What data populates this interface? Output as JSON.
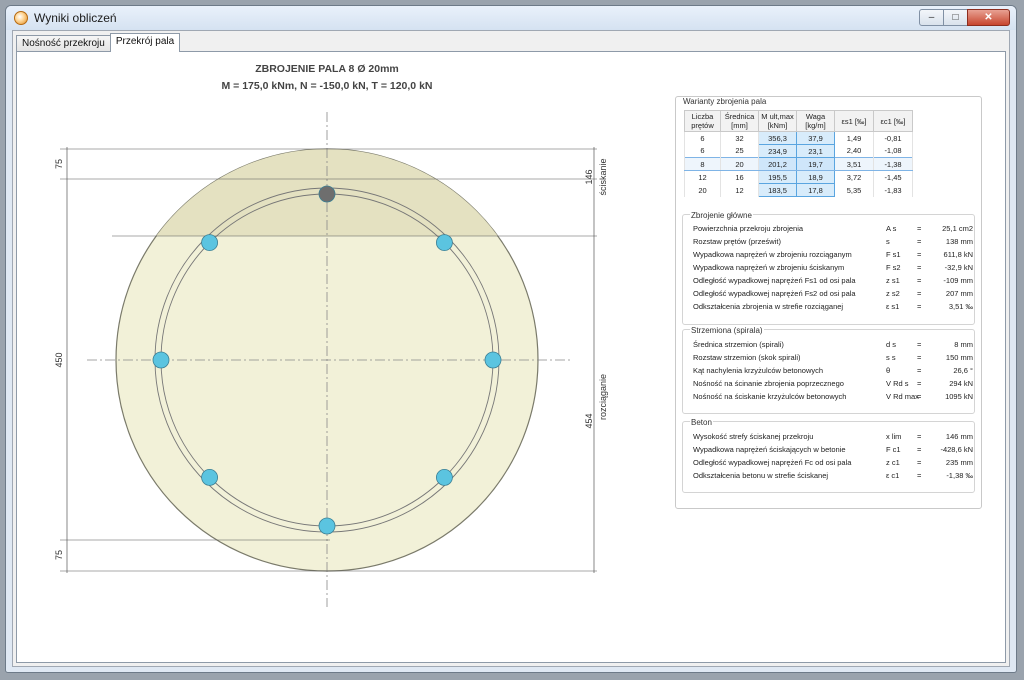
{
  "window": {
    "title": "Wyniki obliczeń",
    "buttons": {
      "minimize": "–",
      "maximize": "□",
      "close": "✕"
    }
  },
  "tabs": [
    {
      "label": "Nośność przekroju"
    },
    {
      "label": "Przekrój pala"
    }
  ],
  "drawing": {
    "title": "ZBROJENIE PALA 8 Ø 20mm",
    "subtitle": "M = 175,0 kNm,  N = -150,0 kN,  T = 120,0 kN",
    "dim_left": [
      "75",
      "450",
      "75"
    ],
    "dim_right": [
      "146",
      "454"
    ],
    "zone_labels": [
      "ściskanie",
      "rozciąganie"
    ],
    "colors": {
      "concrete": "#f2f1d8",
      "compressed": "#e4e1c1",
      "bar": "#5bc4e0",
      "bar_active": "#6e6e6e"
    }
  },
  "variants": {
    "title": "Warianty zbrojenia pala",
    "headers": [
      "Liczba prętów",
      "Średnica [mm]",
      "M ult,max [kNm]",
      "Waga [kg/m]",
      "εs1 [‰]",
      "εc1 [‰]"
    ],
    "rows": [
      [
        "6",
        "32",
        "356,3",
        "37,9",
        "1,49",
        "-0,81"
      ],
      [
        "6",
        "25",
        "234,9",
        "23,1",
        "2,40",
        "-1,08"
      ],
      [
        "8",
        "20",
        "201,2",
        "19,7",
        "3,51",
        "-1,38"
      ],
      [
        "12",
        "16",
        "195,5",
        "18,9",
        "3,72",
        "-1,45"
      ],
      [
        "20",
        "12",
        "183,5",
        "17,8",
        "5,35",
        "-1,83"
      ]
    ],
    "selected_row": 2
  },
  "main_reinf": {
    "title": "Zbrojenie główne",
    "rows": [
      {
        "label": "Powierzchnia przekroju zbrojenia",
        "symbol": "A s",
        "value": "25,1 cm2"
      },
      {
        "label": "Rozstaw prętów (prześwit)",
        "symbol": "s",
        "value": "138 mm"
      },
      {
        "label": "Wypadkowa naprężeń w zbrojeniu rozciąganym",
        "symbol": "F s1",
        "value": "611,8 kN"
      },
      {
        "label": "Wypadkowa naprężeń w zbrojeniu ściskanym",
        "symbol": "F s2",
        "value": "-32,9 kN"
      },
      {
        "label": "Odległość wypadkowej naprężeń Fs1 od osi pala",
        "symbol": "z s1",
        "value": "-109 mm"
      },
      {
        "label": "Odległość wypadkowej naprężeń Fs2 od osi pala",
        "symbol": "z s2",
        "value": "207 mm"
      },
      {
        "label": "Odkształcenia zbrojenia w strefie rozciąganej",
        "symbol": "ε s1",
        "value": "3,51 ‰"
      }
    ]
  },
  "stirrups": {
    "title": "Strzemiona (spirala)",
    "rows": [
      {
        "label": "Średnica strzemion (spirali)",
        "symbol": "d s",
        "value": "8 mm"
      },
      {
        "label": "Rozstaw strzemion (skok spirali)",
        "symbol": "s s",
        "value": "150 mm"
      },
      {
        "label": "Kąt nachylenia krzyżulców betonowych",
        "symbol": "θ",
        "value": "26,6 °"
      },
      {
        "label": "Nośność na ścinanie zbrojenia poprzecznego",
        "symbol": "V Rd s",
        "value": "294 kN"
      },
      {
        "label": "Nośność na ściskanie krzyżulców betonowych",
        "symbol": "V Rd max",
        "value": "1095 kN"
      }
    ]
  },
  "concrete": {
    "title": "Beton",
    "rows": [
      {
        "label": "Wysokość strefy ściskanej przekroju",
        "symbol": "x lim",
        "value": "146 mm"
      },
      {
        "label": "Wypadkowa naprężeń ściskających w betonie",
        "symbol": "F c1",
        "value": "-428,6 kN"
      },
      {
        "label": "Odległość wypadkowej naprężeń Fc od osi pala",
        "symbol": "z c1",
        "value": "235 mm"
      },
      {
        "label": "Odkształcenia betonu w strefie ściskanej",
        "symbol": "ε c1",
        "value": "-1,38 ‰"
      }
    ]
  }
}
